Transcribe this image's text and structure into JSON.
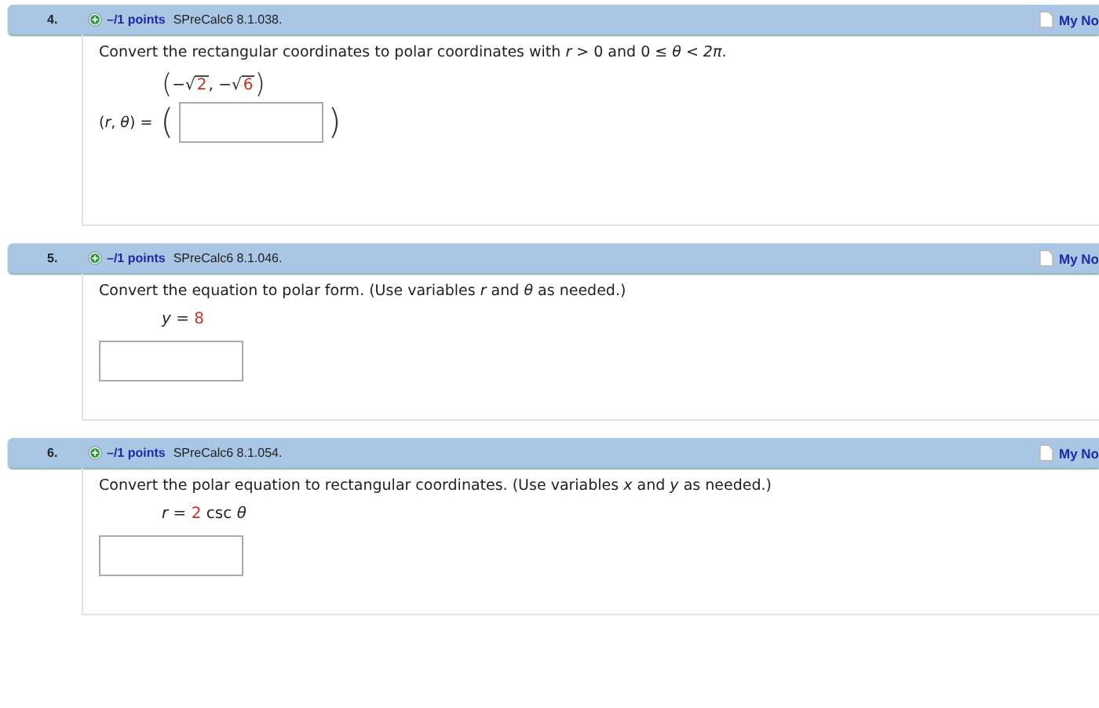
{
  "questions": [
    {
      "number": "4.",
      "points": "–/1 points",
      "code": "SPreCalc6 8.1.038.",
      "notes": "My No",
      "prompt": "Convert the rectangular coordinates to polar coordinates with *r* > 0 and 0 ≤ *θ* < *2π*.",
      "given": [
        {
          "kind": "paren",
          "text": "("
        },
        {
          "kind": "text",
          "text": "−"
        },
        {
          "kind": "sqrt",
          "sign": "√",
          "text": "2"
        },
        {
          "kind": "text",
          "text": ", −"
        },
        {
          "kind": "sqrt",
          "sign": "√",
          "text": "6"
        },
        {
          "kind": "paren",
          "text": ")"
        }
      ],
      "answer": {
        "prefix": "(*r*, *θ*) =",
        "open": "(",
        "close": ")"
      }
    },
    {
      "number": "5.",
      "points": "–/1 points",
      "code": "SPreCalc6 8.1.046.",
      "notes": "My No",
      "prompt": "Convert the equation to polar form. (Use variables *r* and *θ* as needed.)",
      "given": [
        {
          "kind": "var",
          "text": "y"
        },
        {
          "kind": "text",
          "text": " = "
        },
        {
          "kind": "num",
          "text": "8"
        }
      ]
    },
    {
      "number": "6.",
      "points": "–/1 points",
      "code": "SPreCalc6 8.1.054.",
      "notes": "My No",
      "prompt": "Convert the polar equation to rectangular coordinates. (Use variables *x* and *y* as needed.)",
      "given": [
        {
          "kind": "var",
          "text": "r"
        },
        {
          "kind": "text",
          "text": " = "
        },
        {
          "kind": "num",
          "text": "2"
        },
        {
          "kind": "text",
          "text": " csc "
        },
        {
          "kind": "var",
          "text": "θ"
        }
      ]
    }
  ]
}
